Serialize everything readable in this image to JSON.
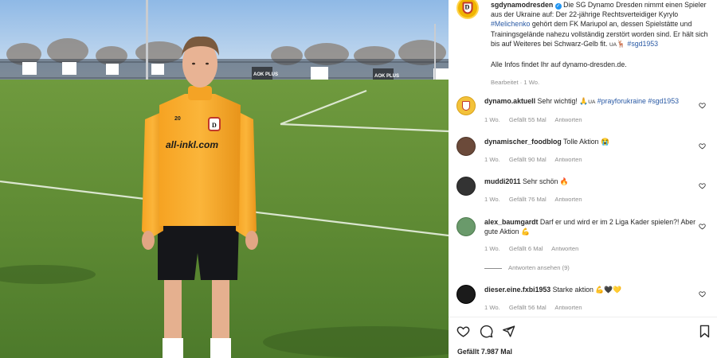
{
  "post": {
    "username": "sgdynamodresden",
    "caption_part1": "Die SG Dynamo Dresden nimmt einen Spieler aus der Ukraine auf: Der 22-jährige Rechtsverteidiger Kyrylo",
    "caption_tag1": "#Melichenko",
    "caption_part2": "gehört dem FK Mariupol an, dessen Spielstätte und Trainingsgelände nahezu vollständig zerstört worden sind. Er hält sich bis auf Weiteres bei Schwarz-Gelb fit.",
    "caption_ua": "UA",
    "caption_tag2": "#sgd1953",
    "caption_part3": "Alle Infos findet Ihr auf dynamo-dresden.de.",
    "edited_meta": "Bearbeitet · 1 Wo."
  },
  "comments": [
    {
      "username": "dynamo.aktuell",
      "text": "Sehr wichtig! ",
      "ua": "UA",
      "tags": "#prayforukraine #sgd1953",
      "time": "1 Wo.",
      "likes": "Gefällt 55 Mal",
      "reply": "Antworten"
    },
    {
      "username": "dynamischer_foodblog",
      "text": "Tolle Aktion",
      "emoji": "😭",
      "time": "1 Wo.",
      "likes": "Gefällt 90 Mal",
      "reply": "Antworten"
    },
    {
      "username": "muddi2011",
      "text": "Sehr schön",
      "emoji": "🔥",
      "time": "1 Wo.",
      "likes": "Gefällt 76 Mal",
      "reply": "Antworten"
    },
    {
      "username": "alex_baumgardt",
      "text": "Darf er und wird er im 2 Liga Kader spielen?! Aber gute Aktion",
      "emoji": "💪",
      "time": "1 Wo.",
      "likes": "Gefällt 6 Mal",
      "reply": "Antworten"
    },
    {
      "username": "dieser.eine.fxbi1953",
      "text": "Starke aktion",
      "emoji": "💪🖤💛",
      "time": "1 Wo.",
      "likes": "Gefällt 56 Mal",
      "reply": "Antworten"
    }
  ],
  "view_replies": "Antworten ansehen (9)",
  "likes_total": "Gefällt 7.987 Mal",
  "photo": {
    "shirt_text": "all-inkl.com",
    "shirt_number": "20",
    "board_text": "AOK PLUS",
    "crest_letter": "D"
  },
  "icons": [
    "heart-icon",
    "comment-icon",
    "share-icon",
    "bookmark-icon",
    "verified-icon"
  ]
}
